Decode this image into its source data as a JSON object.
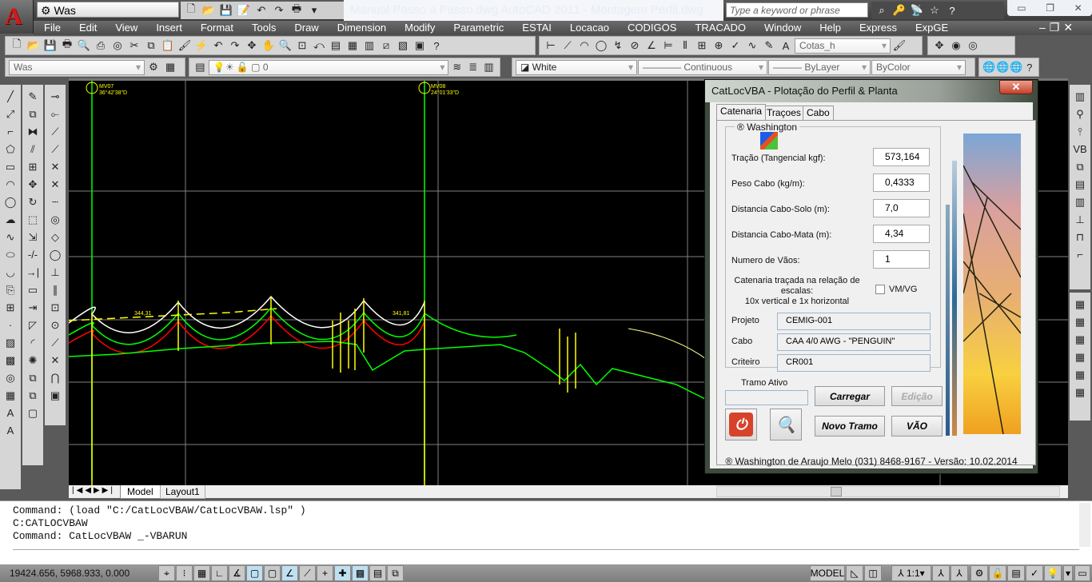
{
  "app": {
    "workspace": "Was",
    "title": "Manual Passo a Passo.dwg  AutoCAD 2011 - Montagem Perfil.dwg",
    "search_placeholder": "Type a keyword or phrase"
  },
  "menu": [
    "File",
    "Edit",
    "View",
    "Insert",
    "Format",
    "Tools",
    "Draw",
    "Dimension",
    "Modify",
    "Parametric",
    "ESTAI",
    "Locacao",
    "CODIGOS",
    "TRACADO",
    "Window",
    "Help",
    "Express",
    "ExpGE"
  ],
  "toolbar": {
    "dimstyle": "Cotas_h",
    "workspace_combo": "Was",
    "layer": "0",
    "color": "White",
    "linetype": "Continuous",
    "lineweight": "ByLayer",
    "plotstyle": "ByColor"
  },
  "drawing": {
    "bg": "#000000",
    "labels": {
      "mv07": "MV07",
      "mv07_angle": "36°42'38\"D",
      "mv08": "MV08",
      "mv08_angle": "24°01'33\"D",
      "span1": "344,31",
      "span4": "341,81"
    },
    "colors": {
      "cable": "#ffffff",
      "clearance": "#00ff00",
      "vegetation": "#ff0000",
      "ground": "#00ff00",
      "structure": "#ffff00",
      "grid": "#808080"
    }
  },
  "dialog": {
    "title": "CatLocVBA - Plotação do Perfil & Planta",
    "tabs": [
      "Catenaria",
      "Traçoes",
      "Cabo"
    ],
    "group": "® Washington",
    "fields": [
      {
        "label": "Tração (Tangencial kgf):",
        "value": "573,164"
      },
      {
        "label": "Peso Cabo (kg/m):",
        "value": "0,4333"
      },
      {
        "label": "Distancia Cabo-Solo (m):",
        "value": "7,0"
      },
      {
        "label": "Distancia Cabo-Mata (m):",
        "value": "4,34"
      },
      {
        "label": "Numero de Vãos:",
        "value": "1"
      }
    ],
    "note": [
      "Catenaria traçada na relação de",
      "escalas:",
      "10x vertical e 1x horizontal"
    ],
    "checkbox": {
      "label": "VM/VG",
      "checked": false
    },
    "info": [
      {
        "label": "Projeto",
        "value": "CEMIG-001"
      },
      {
        "label": "Cabo",
        "value": "CAA 4/0 AWG - \"PENGUIN\""
      },
      {
        "label": "Criteiro",
        "value": "CR001"
      }
    ],
    "tramo_label": "Tramo Ativo",
    "tramo_value": "",
    "buttons": {
      "carregar": "Carregar",
      "edicao": "Edição",
      "novo": "Novo Tramo",
      "vao": "VÃO"
    },
    "footer": "® Washington de Araujo Melo (031) 8468-9167 - Versão: 10.02.2014"
  },
  "layout_tabs": [
    "Model",
    "Layout1"
  ],
  "command": [
    "Command: (load \"C:/CatLocVBAW/CatLocVBAW.lsp\" )",
    "C:CATLOCVBAW",
    "Command: CatLocVBAW _-VBARUN"
  ],
  "status": {
    "coords": "19424.656, 5968.933, 0.000",
    "model": "MODEL",
    "scale": "1:1"
  }
}
